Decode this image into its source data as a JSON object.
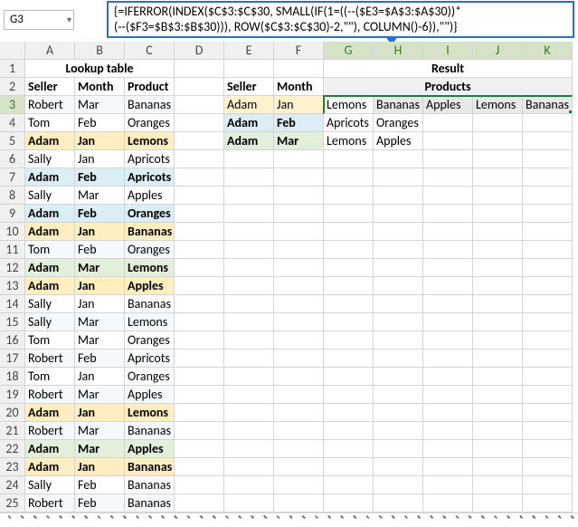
{
  "name_box": "G3",
  "formula_line1": "{=IFERROR(INDEX($C$3:$C$30, SMALL(IF(1=((--($E3=$A$3:$A$30))*",
  "formula_line2": "(--($F3=$B$3:$B$30))), ROW($C$3:$C$30)-2,\"\"), COLUMN()-6)),\"\")}",
  "columns": [
    "A",
    "B",
    "C",
    "D",
    "E",
    "F",
    "G",
    "H",
    "I",
    "J",
    "K"
  ],
  "title_lookup": "Lookup table",
  "title_result": "Result",
  "title_products": "Products",
  "hdr": {
    "seller": "Seller",
    "month": "Month",
    "product": "Product"
  },
  "lookup": [
    {
      "s": "Robert",
      "m": "Mar",
      "p": "Bananas",
      "hl": ""
    },
    {
      "s": "Tom",
      "m": "Feb",
      "p": "Oranges",
      "hl": ""
    },
    {
      "s": "Adam",
      "m": "Jan",
      "p": "Lemons",
      "hl": "yellow"
    },
    {
      "s": "Sally",
      "m": "Jan",
      "p": "Apricots",
      "hl": ""
    },
    {
      "s": "Adam",
      "m": "Feb",
      "p": "Apricots",
      "hl": "blue"
    },
    {
      "s": "Sally",
      "m": "Mar",
      "p": "Apples",
      "hl": ""
    },
    {
      "s": "Adam",
      "m": "Feb",
      "p": "Oranges",
      "hl": "blue"
    },
    {
      "s": "Adam",
      "m": "Jan",
      "p": "Bananas",
      "hl": "yellow"
    },
    {
      "s": "Tom",
      "m": "Feb",
      "p": "Oranges",
      "hl": ""
    },
    {
      "s": "Adam",
      "m": "Mar",
      "p": "Lemons",
      "hl": "green"
    },
    {
      "s": "Adam",
      "m": "Jan",
      "p": "Apples",
      "hl": "yellow"
    },
    {
      "s": "Sally",
      "m": "Jan",
      "p": "Bananas",
      "hl": ""
    },
    {
      "s": "Sally",
      "m": "Mar",
      "p": "Lemons",
      "hl": ""
    },
    {
      "s": "Tom",
      "m": "Mar",
      "p": "Oranges",
      "hl": ""
    },
    {
      "s": "Robert",
      "m": "Feb",
      "p": "Apricots",
      "hl": ""
    },
    {
      "s": "Tom",
      "m": "Jan",
      "p": "Oranges",
      "hl": ""
    },
    {
      "s": "Robert",
      "m": "Mar",
      "p": "Apples",
      "hl": ""
    },
    {
      "s": "Adam",
      "m": "Jan",
      "p": "Lemons",
      "hl": "yellow"
    },
    {
      "s": "Robert",
      "m": "Mar",
      "p": "Bananas",
      "hl": ""
    },
    {
      "s": "Adam",
      "m": "Mar",
      "p": "Apples",
      "hl": "green"
    },
    {
      "s": "Adam",
      "m": "Jan",
      "p": "Bananas",
      "hl": "yellow"
    },
    {
      "s": "Sally",
      "m": "Feb",
      "p": "Bananas",
      "hl": ""
    },
    {
      "s": "Robert",
      "m": "Feb",
      "p": "Bananas",
      "hl": ""
    }
  ],
  "result_header_rows": [
    {
      "seller": "Adam",
      "month": "Jan",
      "row_hl": "curr"
    },
    {
      "seller": "Adam",
      "month": "Feb",
      "row_hl": "blue"
    },
    {
      "seller": "Adam",
      "month": "Mar",
      "row_hl": "green"
    }
  ],
  "result_products": {
    "r3": [
      "Lemons",
      "Bananas",
      "Apples",
      "Lemons",
      "Bananas"
    ],
    "r4": [
      "Apricots",
      "Oranges",
      "",
      "",
      ""
    ],
    "r5": [
      "Lemons",
      "Apples",
      "",
      "",
      ""
    ]
  }
}
